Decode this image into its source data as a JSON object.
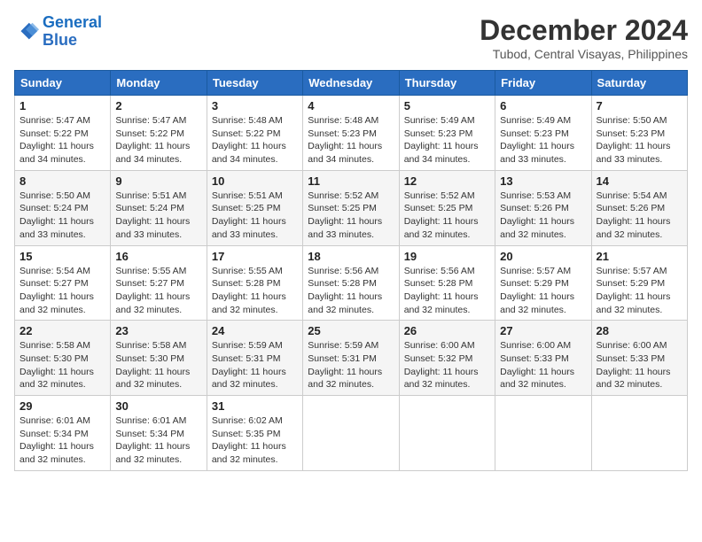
{
  "logo": {
    "line1": "General",
    "line2": "Blue"
  },
  "title": "December 2024",
  "subtitle": "Tubod, Central Visayas, Philippines",
  "days_of_week": [
    "Sunday",
    "Monday",
    "Tuesday",
    "Wednesday",
    "Thursday",
    "Friday",
    "Saturday"
  ],
  "weeks": [
    [
      {
        "day": "1",
        "info": "Sunrise: 5:47 AM\nSunset: 5:22 PM\nDaylight: 11 hours and 34 minutes."
      },
      {
        "day": "2",
        "info": "Sunrise: 5:47 AM\nSunset: 5:22 PM\nDaylight: 11 hours and 34 minutes."
      },
      {
        "day": "3",
        "info": "Sunrise: 5:48 AM\nSunset: 5:22 PM\nDaylight: 11 hours and 34 minutes."
      },
      {
        "day": "4",
        "info": "Sunrise: 5:48 AM\nSunset: 5:23 PM\nDaylight: 11 hours and 34 minutes."
      },
      {
        "day": "5",
        "info": "Sunrise: 5:49 AM\nSunset: 5:23 PM\nDaylight: 11 hours and 34 minutes."
      },
      {
        "day": "6",
        "info": "Sunrise: 5:49 AM\nSunset: 5:23 PM\nDaylight: 11 hours and 33 minutes."
      },
      {
        "day": "7",
        "info": "Sunrise: 5:50 AM\nSunset: 5:23 PM\nDaylight: 11 hours and 33 minutes."
      }
    ],
    [
      {
        "day": "8",
        "info": "Sunrise: 5:50 AM\nSunset: 5:24 PM\nDaylight: 11 hours and 33 minutes."
      },
      {
        "day": "9",
        "info": "Sunrise: 5:51 AM\nSunset: 5:24 PM\nDaylight: 11 hours and 33 minutes."
      },
      {
        "day": "10",
        "info": "Sunrise: 5:51 AM\nSunset: 5:25 PM\nDaylight: 11 hours and 33 minutes."
      },
      {
        "day": "11",
        "info": "Sunrise: 5:52 AM\nSunset: 5:25 PM\nDaylight: 11 hours and 33 minutes."
      },
      {
        "day": "12",
        "info": "Sunrise: 5:52 AM\nSunset: 5:25 PM\nDaylight: 11 hours and 32 minutes."
      },
      {
        "day": "13",
        "info": "Sunrise: 5:53 AM\nSunset: 5:26 PM\nDaylight: 11 hours and 32 minutes."
      },
      {
        "day": "14",
        "info": "Sunrise: 5:54 AM\nSunset: 5:26 PM\nDaylight: 11 hours and 32 minutes."
      }
    ],
    [
      {
        "day": "15",
        "info": "Sunrise: 5:54 AM\nSunset: 5:27 PM\nDaylight: 11 hours and 32 minutes."
      },
      {
        "day": "16",
        "info": "Sunrise: 5:55 AM\nSunset: 5:27 PM\nDaylight: 11 hours and 32 minutes."
      },
      {
        "day": "17",
        "info": "Sunrise: 5:55 AM\nSunset: 5:28 PM\nDaylight: 11 hours and 32 minutes."
      },
      {
        "day": "18",
        "info": "Sunrise: 5:56 AM\nSunset: 5:28 PM\nDaylight: 11 hours and 32 minutes."
      },
      {
        "day": "19",
        "info": "Sunrise: 5:56 AM\nSunset: 5:28 PM\nDaylight: 11 hours and 32 minutes."
      },
      {
        "day": "20",
        "info": "Sunrise: 5:57 AM\nSunset: 5:29 PM\nDaylight: 11 hours and 32 minutes."
      },
      {
        "day": "21",
        "info": "Sunrise: 5:57 AM\nSunset: 5:29 PM\nDaylight: 11 hours and 32 minutes."
      }
    ],
    [
      {
        "day": "22",
        "info": "Sunrise: 5:58 AM\nSunset: 5:30 PM\nDaylight: 11 hours and 32 minutes."
      },
      {
        "day": "23",
        "info": "Sunrise: 5:58 AM\nSunset: 5:30 PM\nDaylight: 11 hours and 32 minutes."
      },
      {
        "day": "24",
        "info": "Sunrise: 5:59 AM\nSunset: 5:31 PM\nDaylight: 11 hours and 32 minutes."
      },
      {
        "day": "25",
        "info": "Sunrise: 5:59 AM\nSunset: 5:31 PM\nDaylight: 11 hours and 32 minutes."
      },
      {
        "day": "26",
        "info": "Sunrise: 6:00 AM\nSunset: 5:32 PM\nDaylight: 11 hours and 32 minutes."
      },
      {
        "day": "27",
        "info": "Sunrise: 6:00 AM\nSunset: 5:33 PM\nDaylight: 11 hours and 32 minutes."
      },
      {
        "day": "28",
        "info": "Sunrise: 6:00 AM\nSunset: 5:33 PM\nDaylight: 11 hours and 32 minutes."
      }
    ],
    [
      {
        "day": "29",
        "info": "Sunrise: 6:01 AM\nSunset: 5:34 PM\nDaylight: 11 hours and 32 minutes."
      },
      {
        "day": "30",
        "info": "Sunrise: 6:01 AM\nSunset: 5:34 PM\nDaylight: 11 hours and 32 minutes."
      },
      {
        "day": "31",
        "info": "Sunrise: 6:02 AM\nSunset: 5:35 PM\nDaylight: 11 hours and 32 minutes."
      },
      null,
      null,
      null,
      null
    ]
  ]
}
